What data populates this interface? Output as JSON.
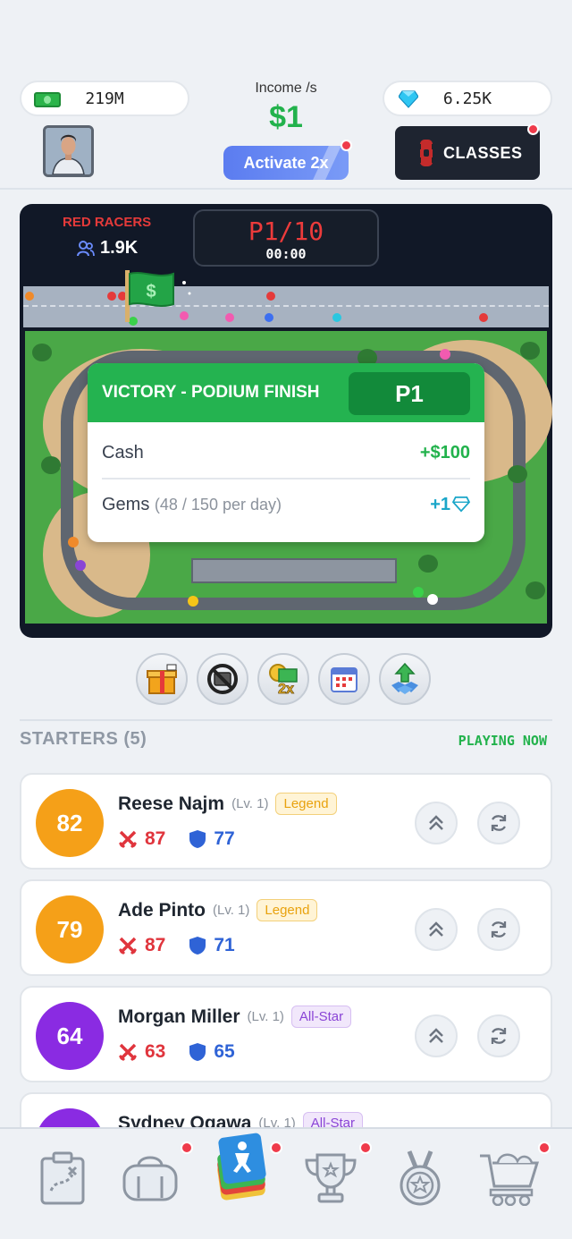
{
  "header": {
    "cash": "219M",
    "gems": "6.25K",
    "income_label": "Income /s",
    "income_value": "$1",
    "activate_label": "Activate 2x",
    "classes_label": "CLASSES"
  },
  "race": {
    "team_name": "RED RACERS",
    "team_fans": "1.9K",
    "position": "P1/10",
    "timer": "00:00"
  },
  "victory": {
    "title": "VICTORY - PODIUM FINISH",
    "position": "P1",
    "cash_label": "Cash",
    "cash_value": "+$100",
    "gems_label": "Gems",
    "gems_sub": "(48 / 150 per day)",
    "gems_value": "+1"
  },
  "actions": [
    "gift-icon",
    "no-ads-icon",
    "double-cash-icon",
    "calendar-icon",
    "gem-boost-icon"
  ],
  "starters": {
    "title": "STARTERS (5)",
    "status": "PLAYING NOW",
    "players": [
      {
        "score": "82",
        "name": "Reese Najm",
        "level": "(Lv. 1)",
        "tier": "Legend",
        "attack": "87",
        "defense": "77",
        "color": "#f5a018"
      },
      {
        "score": "79",
        "name": "Ade Pinto",
        "level": "(Lv. 1)",
        "tier": "Legend",
        "attack": "87",
        "defense": "71",
        "color": "#f5a018"
      },
      {
        "score": "64",
        "name": "Morgan Miller",
        "level": "(Lv. 1)",
        "tier": "All-Star",
        "attack": "63",
        "defense": "65",
        "color": "#8a2be2"
      },
      {
        "score": "",
        "name": "Sydney Ogawa",
        "level": "(Lv. 1)",
        "tier": "All-Star",
        "attack": "",
        "defense": "",
        "color": "#8a2be2"
      }
    ]
  },
  "nav": [
    "clipboard-icon",
    "bag-icon",
    "cards-icon",
    "trophy-icon",
    "medal-icon",
    "cart-icon"
  ],
  "colors": {
    "accent_green": "#22b24c",
    "brand_red": "#e53a3a",
    "legend_gold": "#f5a018",
    "allstar_purple": "#8a2be2"
  }
}
